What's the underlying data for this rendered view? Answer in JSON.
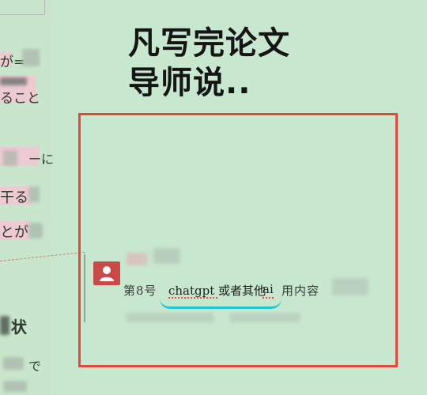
{
  "title": {
    "line1": "凡写完论文",
    "line2": "导师说.."
  },
  "left_column": {
    "lines": [
      "が=",
      "ること",
      "ーに",
      "干る",
      "とが",
      "状",
      "で"
    ]
  },
  "comment": {
    "garbled_prefix": "第8号",
    "text": "chatgpt 或者其他",
    "ai_word": "ai",
    "garbled_suffix": "用内容"
  },
  "colors": {
    "highlight_border": "#e34a3d",
    "underline": "#1fc6d6",
    "avatar": "#c94848"
  }
}
